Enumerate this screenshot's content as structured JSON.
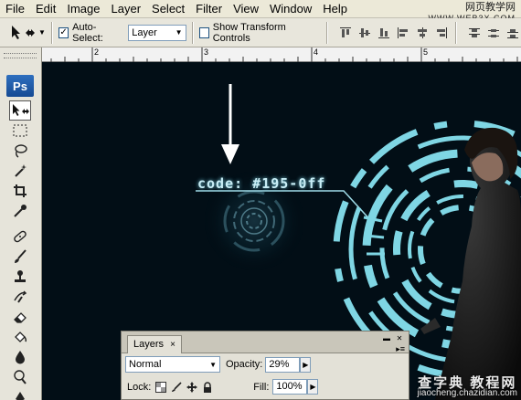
{
  "menubar": {
    "items": [
      "File",
      "Edit",
      "Image",
      "Layer",
      "Select",
      "Filter",
      "View",
      "Window",
      "Help"
    ]
  },
  "watermark_top": {
    "line1": "网页教学网",
    "line2": "WWW.WEB3X.COM"
  },
  "options": {
    "auto_select_label": "Auto-Select:",
    "auto_select_checked": true,
    "auto_select_value": "Layer",
    "show_transform_label": "Show Transform Controls",
    "show_transform_checked": false
  },
  "toolbox": {
    "logo": "Ps"
  },
  "ruler": {
    "numbers": [
      "2",
      "3",
      "4",
      "5"
    ]
  },
  "canvas": {
    "code_text": "code: #195-0ff",
    "accent": "#7fd6e4"
  },
  "layers": {
    "tab_label": "Layers",
    "tab_close": "×",
    "blend_mode": "Normal",
    "opacity_label": "Opacity:",
    "opacity_value": "29%",
    "lock_label": "Lock:",
    "fill_label": "Fill:",
    "fill_value": "100%"
  },
  "watermark_bottom": {
    "line1": "查字典 教程网",
    "line2": "jiaocheng.chazidian.com"
  }
}
